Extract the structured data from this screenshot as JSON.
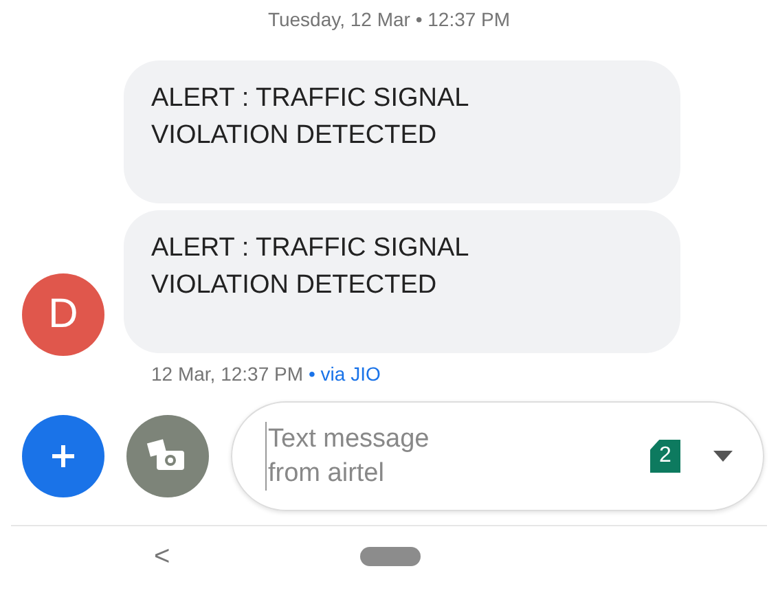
{
  "date_header": "Tuesday, 12 Mar • 12:37 PM",
  "messages": [
    {
      "text": "ALERT : TRAFFIC SIGNAL VIOLATION DETECTED",
      "show_avatar": false
    },
    {
      "text": "ALERT : TRAFFIC SIGNAL VIOLATION DETECTED",
      "show_avatar": true
    }
  ],
  "sender": {
    "initial": "D",
    "color": "#e0574c"
  },
  "meta": {
    "time": "12 Mar, 12:37 PM",
    "via": "• via JIO"
  },
  "compose": {
    "placeholder": "Text message from airtel",
    "sim": "2"
  },
  "nav": {
    "back": "<"
  }
}
